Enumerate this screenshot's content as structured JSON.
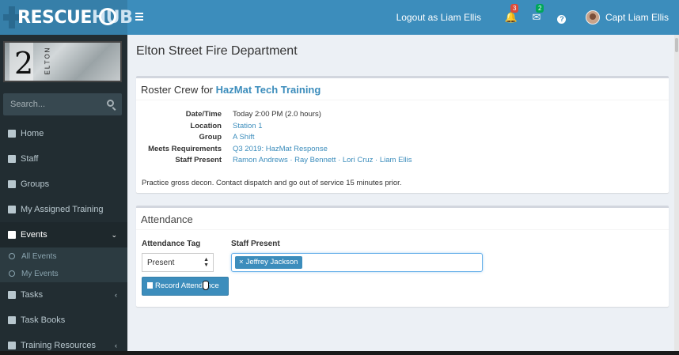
{
  "app": {
    "logo_main": "RESCUE",
    "logo_accent": "HUB"
  },
  "header": {
    "logout": "Logout as Liam Ellis",
    "notifications_count": "3",
    "messages_count": "2",
    "help_glyph": "?",
    "user_name": "Capt Liam Ellis"
  },
  "sidebar": {
    "dept_logo": {
      "number": "2",
      "word": "ELTON"
    },
    "search_placeholder": "Search...",
    "items": [
      {
        "label": "Home",
        "icon": "home-icon"
      },
      {
        "label": "Staff",
        "icon": "user-icon"
      },
      {
        "label": "Groups",
        "icon": "users-icon"
      },
      {
        "label": "My Assigned Training",
        "icon": "book-icon"
      },
      {
        "label": "Events",
        "icon": "calendar-icon",
        "arrow": "⌄"
      },
      {
        "label": "Tasks",
        "icon": "list-icon",
        "arrow": "‹"
      },
      {
        "label": "Task Books",
        "icon": "id-card-icon"
      },
      {
        "label": "Training Resources",
        "icon": "file-icon",
        "arrow": "‹"
      }
    ],
    "sub_items": [
      "All Events",
      "My Events"
    ]
  },
  "main": {
    "title": "Elton Street Fire Department",
    "roster": {
      "heading_prefix": "Roster Crew for ",
      "heading_link": "HazMat Tech Training",
      "details": [
        {
          "label": "Date/Time",
          "value": "Today 2:00 PM (2.0 hours)"
        },
        {
          "label": "Location",
          "value": "Station 1"
        },
        {
          "label": "Group",
          "value": "A Shift"
        },
        {
          "label": "Meets Requirements",
          "value": "Q3 2019: HazMat Response"
        },
        {
          "label": "Staff Present",
          "value": "Ramon Andrews · Ray Bennett · Lori Cruz · Liam Ellis"
        }
      ],
      "note": "Practice gross decon. Contact dispatch and go out of service 15 minutes prior."
    },
    "attendance": {
      "heading": "Attendance",
      "tag_label": "Attendance Tag",
      "tag_value": "Present",
      "staff_label": "Staff Present",
      "selected_staff": "Jeffrey Jackson",
      "remove_glyph": "×",
      "record_button": "Record Attendance"
    }
  },
  "colors": {
    "primary": "#3c8dbc",
    "sidebar": "#222d32",
    "danger": "#dd4b39",
    "success": "#00a65a"
  }
}
